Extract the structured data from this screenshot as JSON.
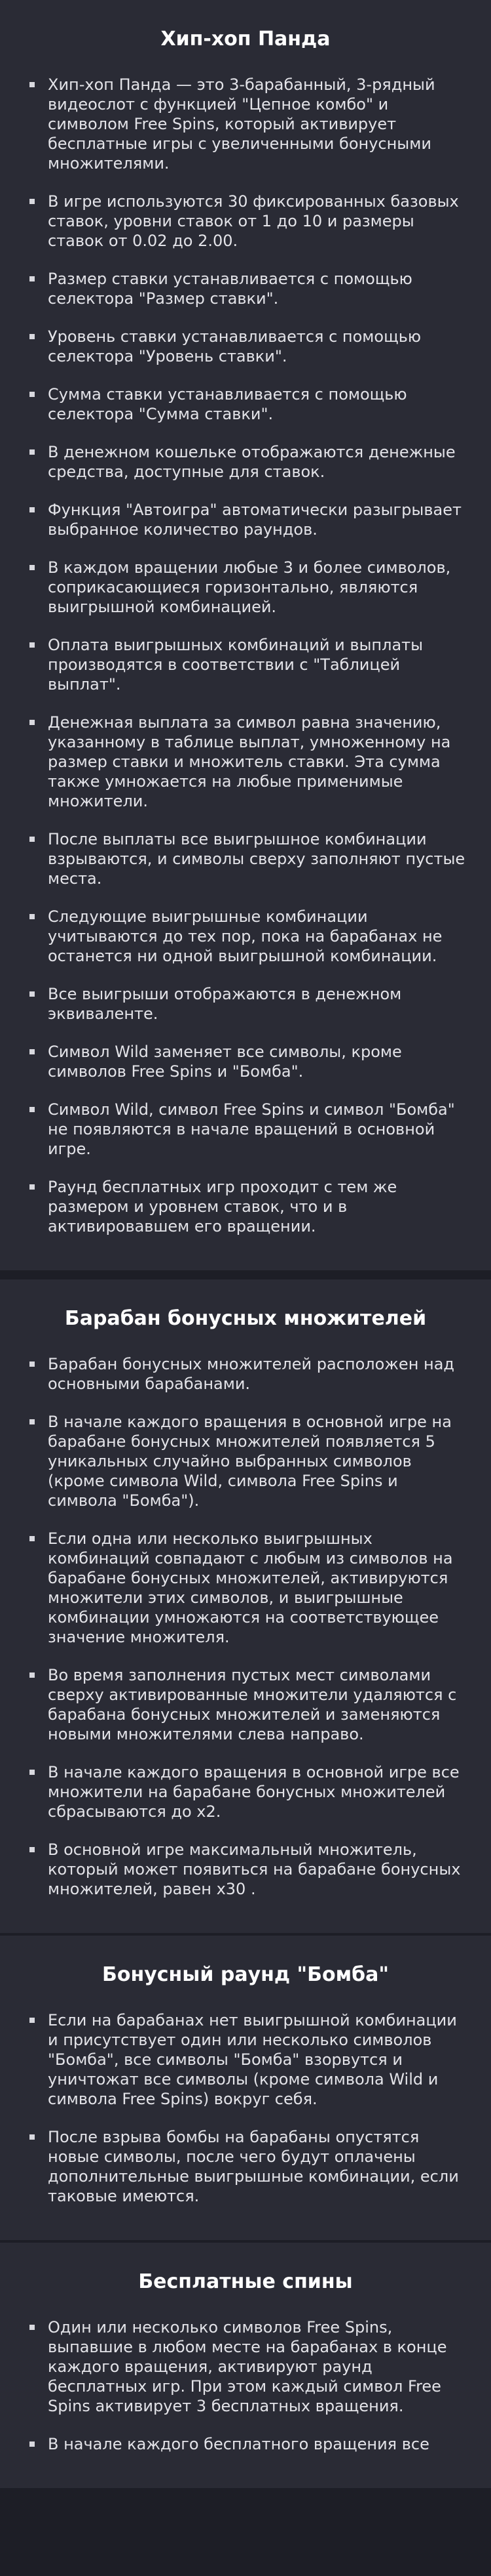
{
  "sections": [
    {
      "title": "Хип-хоп Панда",
      "items": [
        "Хип-хоп Панда — это 3-барабанный, 3-рядный видеослот с функцией \"Цепное комбо\" и символом Free Spins, который активирует бесплатные игры с увеличенными бонусными множителями.",
        "В игре используются 30 фиксированных базовых ставок, уровни ставок от 1 до 10 и размеры ставок от 0.02 до 2.00.",
        "Размер ставки устанавливается с помощью селектора \"Размер ставки\".",
        "Уровень ставки устанавливается с помощью селектора \"Уровень ставки\".",
        "Сумма ставки устанавливается с помощью селектора \"Сумма ставки\".",
        "В денежном кошельке отображаются денежные средства, доступные для ставок.",
        "Функция \"Автоигра\" автоматически разыгрывает выбранное количество раундов.",
        "В каждом вращении любые 3 и более символов, соприкасающиеся горизонтально, являются выигрышной комбинацией.",
        "Оплата выигрышных комбинаций и выплаты производятся в соответствии с \"Таблицей выплат\".",
        "Денежная выплата за символ равна значению, указанному в таблице выплат, умноженному на размер ставки и множитель ставки. Эта сумма также умножается на любые применимые множители.",
        "После выплаты все выигрышное комбинации взрываются, и символы сверху заполняют пустые места.",
        "Следующие выигрышные комбинации учитываются до тех пор, пока на барабанах не останется ни одной выигрышной комбинации.",
        "Все выигрыши отображаются в денежном эквиваленте.",
        "Символ Wild заменяет все символы, кроме символов Free Spins и \"Бомба\".",
        "Символ Wild, символ Free Spins и символ \"Бомба\" не появляются в начале вращений в основной игре.",
        "Раунд бесплатных игр проходит с тем же размером и уровнем ставок, что и в активировавшем его вращении."
      ]
    },
    {
      "title": "Барабан бонусных множителей",
      "items": [
        "Барабан бонусных множителей расположен над основными барабанами.",
        "В начале каждого вращения в основной игре на барабане бонусных множителей появляется 5 уникальных случайно выбранных символов (кроме символа Wild, символа Free Spins и символа \"Бомба\").",
        "Если одна или несколько выигрышных комбинаций совпадают с любым из символов на барабане бонусных множителей, активируются множители этих символов, и выигрышные комбинации умножаются на соответствующее значение множителя.",
        "Во время заполнения пустых мест символами сверху активированные множители удаляются с барабана бонусных множителей и заменяются новыми множителями слева направо.",
        "В начале каждого вращения в основной игре все множители на барабане бонусных множителей сбрасываются до x2.",
        "В основной игре максимальный множитель, который может появиться на барабане бонусных множителей, равен x30 ."
      ]
    },
    {
      "title": "Бонусный раунд \"Бомба\"",
      "items": [
        "Если на барабанах нет выигрышной комбинации и присутствует один или несколько символов \"Бомба\", все символы \"Бомба\" взорвутся и уничтожат все символы (кроме символа Wild и символа Free Spins) вокруг себя.",
        "После взрыва бомбы на барабаны опустятся новые символы, после чего будут оплачены дополнительные выигрышные комбинации, если таковые имеются."
      ]
    },
    {
      "title": "Бесплатные спины",
      "items": [
        "Один или несколько символов Free Spins, выпавшие в любом месте на барабанах в конце каждого вращения, активируют раунд бесплатных игр. При этом каждый символ Free Spins активирует 3 бесплатных вращения.",
        "В начале каждого бесплатного вращения все"
      ]
    }
  ]
}
